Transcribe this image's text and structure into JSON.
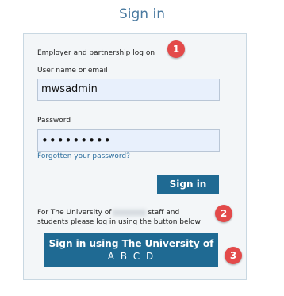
{
  "title": "Sign in",
  "login_heading": "Employer and partnership log on",
  "username": {
    "label": "User name or email",
    "value": "mwsadmin"
  },
  "password": {
    "label": "Password",
    "value": "•••••••••"
  },
  "forgot_link": "Forgotten your password?",
  "signin_button": "Sign in",
  "university_note": {
    "line1_prefix": "For The University of",
    "line1_suffix": "staff and",
    "line2": "students please log in using the button below"
  },
  "sso_button": {
    "line1": "Sign in using The University of",
    "line2": "A B C D"
  },
  "annotations": [
    "1",
    "2",
    "3"
  ],
  "colors": {
    "accent": "#1f6a93",
    "title": "#4a7aa0",
    "badge": "#e34a4a",
    "input_bg": "#e8f0fc"
  }
}
